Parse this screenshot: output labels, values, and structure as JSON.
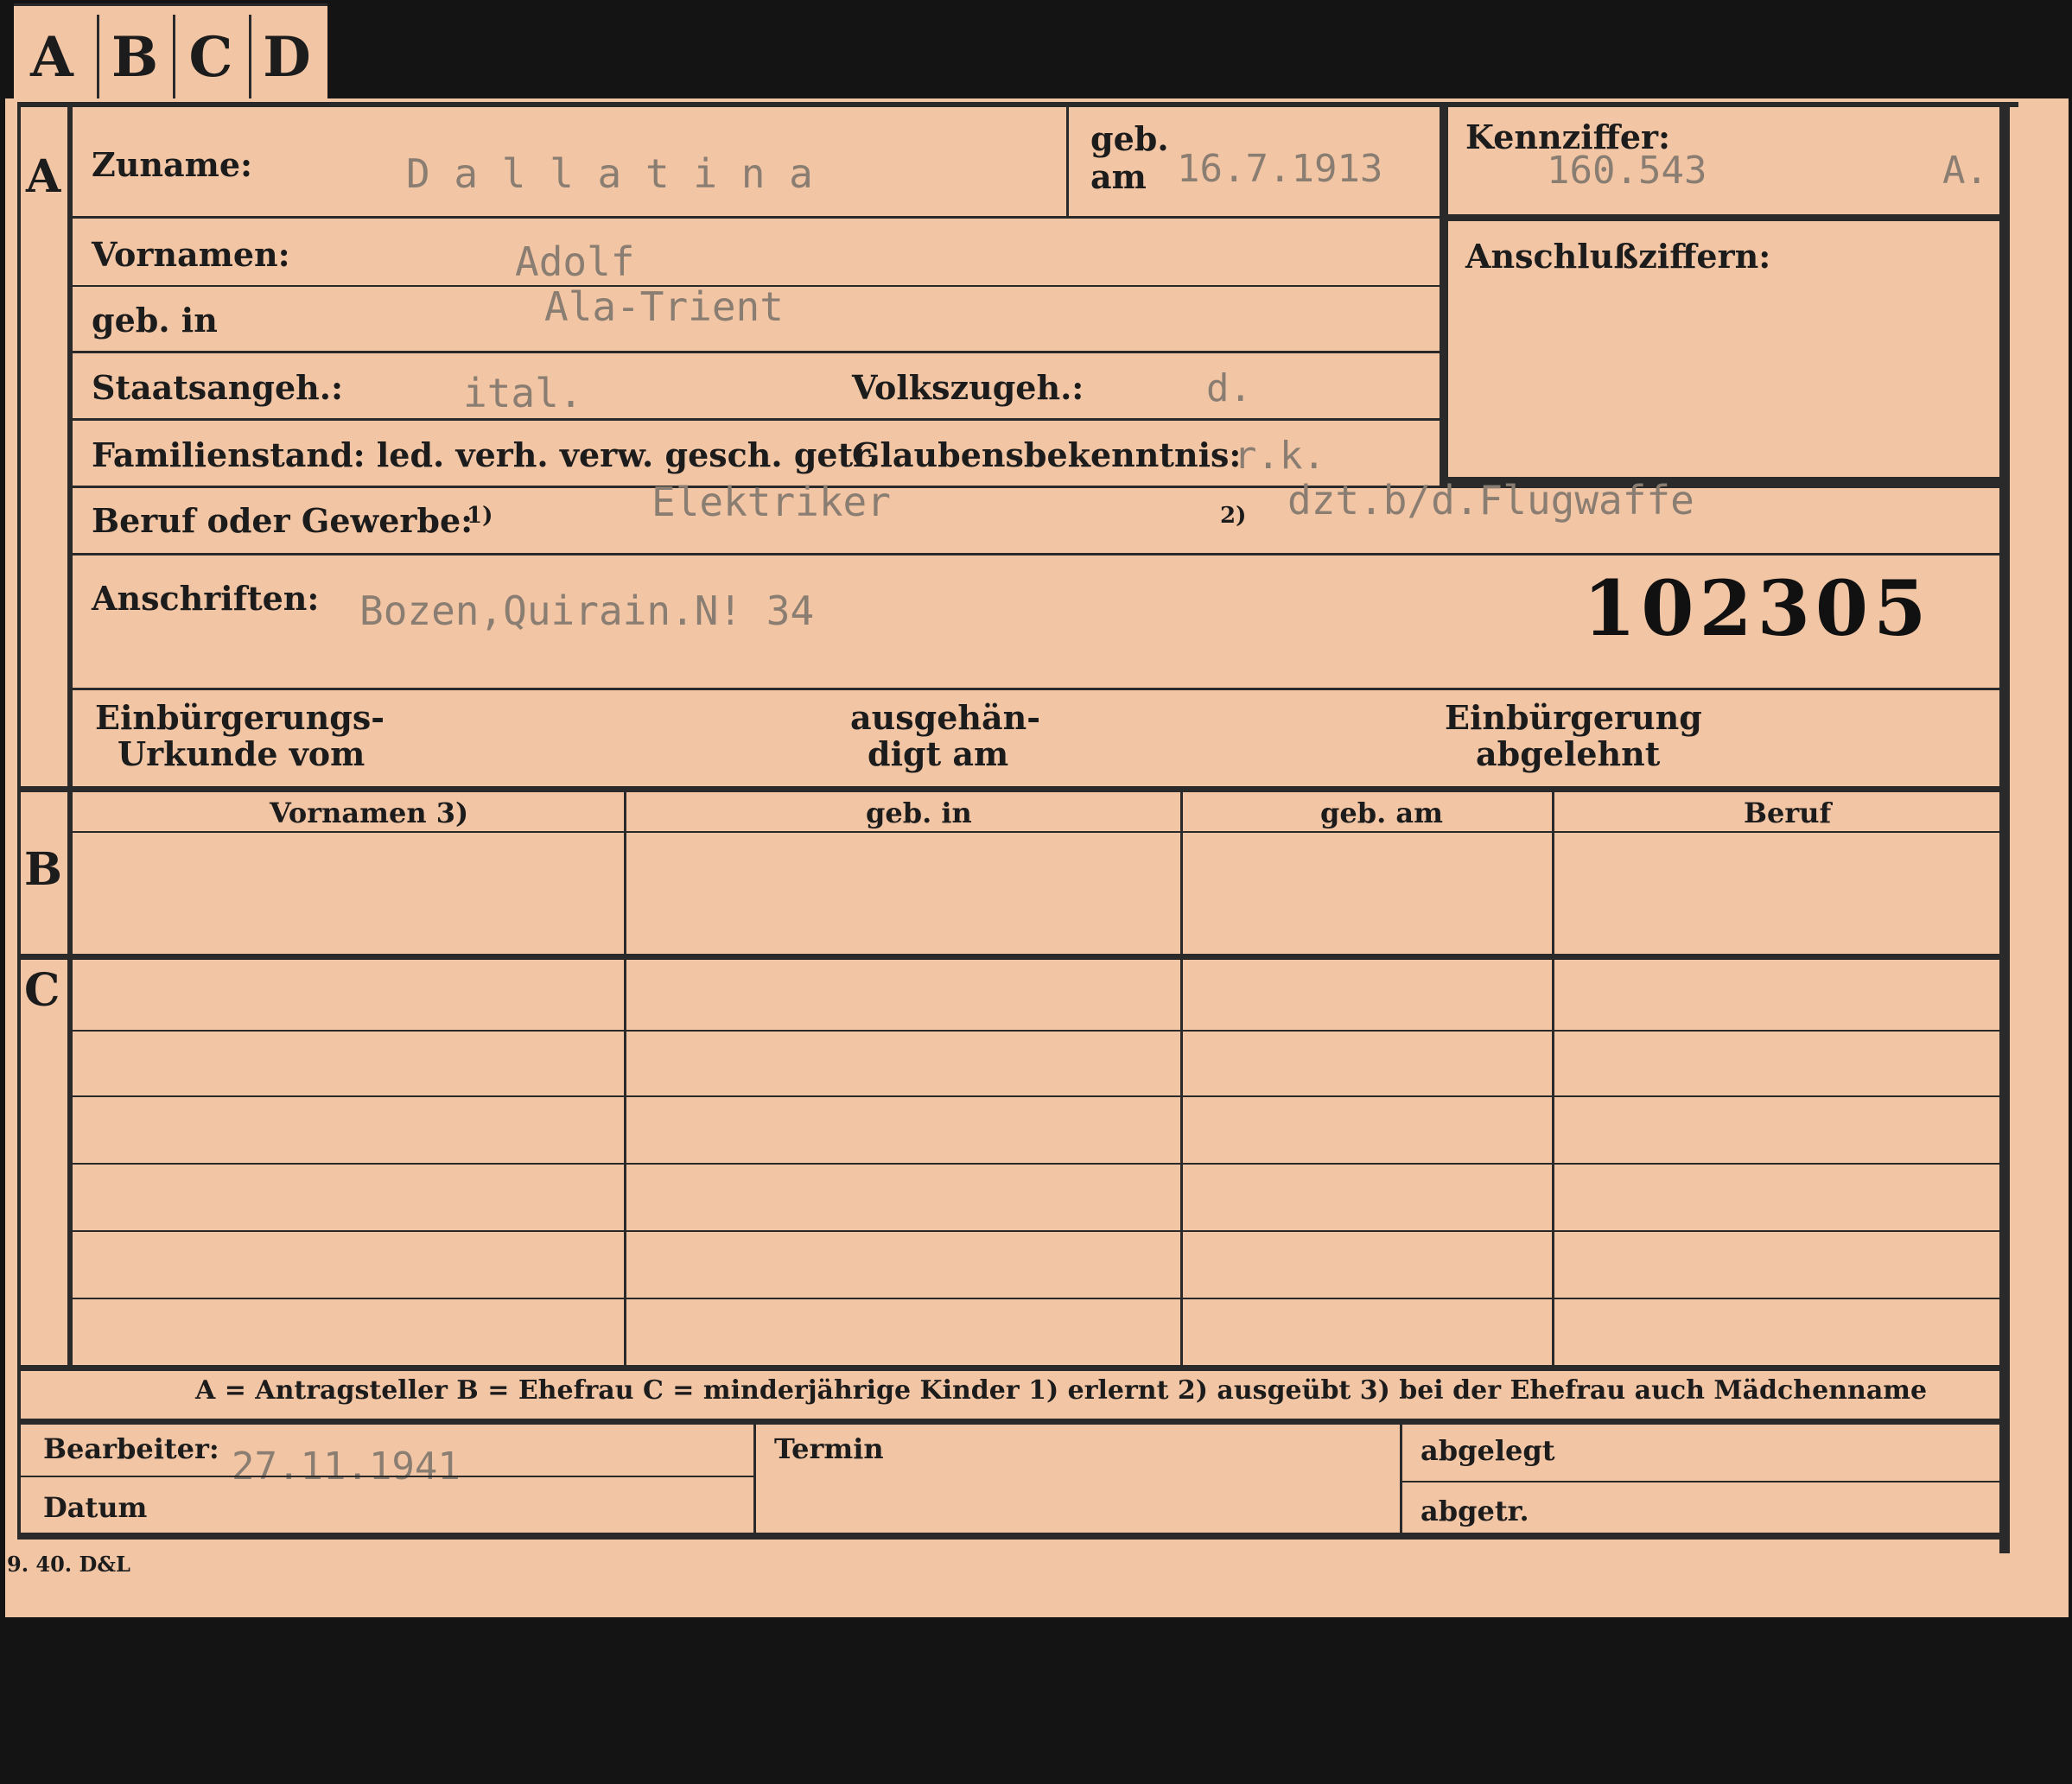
{
  "tabs": [
    "A",
    "B",
    "C",
    "D"
  ],
  "labels": {
    "zuname": "Zuname:",
    "geb_am_geb": "geb.",
    "geb_am_am": "am",
    "kennziffer": "Kennziffer:",
    "vornamen": "Vornamen:",
    "geb_in": "geb. in",
    "anschlussziffern": "Anschlußziffern:",
    "staatsangeh": "Staatsangeh.:",
    "volkszugeh": "Volkszugeh.:",
    "familienstand": "Familienstand: led. verh. verw. gesch. getr.",
    "glaubensbekenntnis": "Glaubensbekenntnis:",
    "beruf": "Beruf oder Gewerbe:",
    "beruf_fn1": "1)",
    "beruf_fn2": "2)",
    "anschriften": "Anschriften:",
    "einb_urkunde_1": "Einbürgerungs-",
    "einb_urkunde_2": "Urkunde vom",
    "ausgehaendigt_1": "ausgehän-",
    "ausgehaendigt_2": "digt am",
    "einb_abgelehnt_1": "Einbürgerung",
    "einb_abgelehnt_2": "abgelehnt",
    "col_vornamen": "Vornamen 3)",
    "col_geb_in": "geb. in",
    "col_geb_am": "geb. am",
    "col_beruf": "Beruf",
    "legend": "A = Antragsteller   B = Ehefrau   C = minderjährige Kinder   1) erlernt   2) ausgeübt   3) bei der Ehefrau auch Mädchenname",
    "bearbeiter": "Bearbeiter:",
    "datum": "Datum",
    "termin": "Termin",
    "abgelegt": "abgelegt",
    "abgetr": "abgetr.",
    "printer": "9. 40. D&L"
  },
  "sections": [
    "A",
    "B",
    "C"
  ],
  "values": {
    "zuname": "D a l l a t i n a",
    "geb_am": "16.7.1913",
    "kennziffer": "160.543",
    "kennziffer_suffix": "A.",
    "vornamen": "Adolf",
    "geb_in": "Ala-Trient",
    "staatsangeh": "ital.",
    "volkszugeh": "d.",
    "glaubensbekenntnis": "r.k.",
    "beruf_erlernt": "Elektriker",
    "beruf_ausgeuebt": "dzt.b/d.Flugwaffe",
    "anschrift": "Bozen,Quirain.N! 34",
    "stamp_number": "102305",
    "datum": "27.11.1941"
  }
}
